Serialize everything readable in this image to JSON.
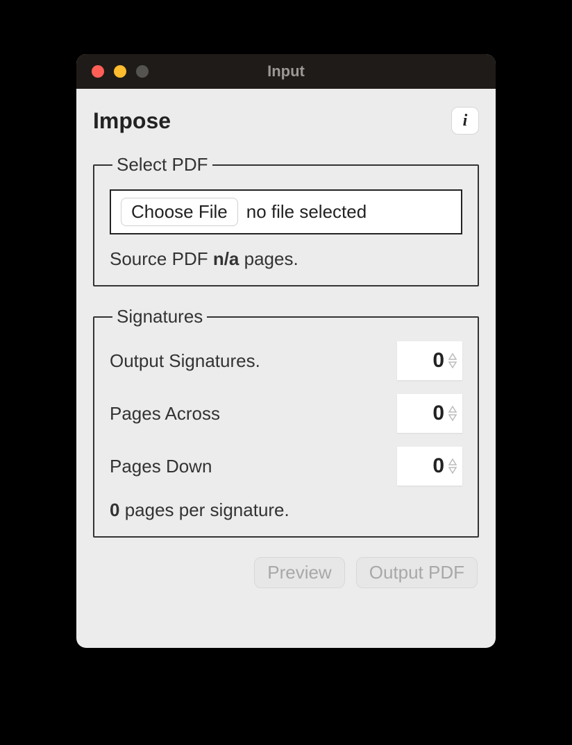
{
  "window": {
    "title": "Input"
  },
  "header": {
    "title": "Impose",
    "info_label": "i"
  },
  "select_pdf": {
    "legend": "Select PDF",
    "choose_label": "Choose File",
    "no_file_label": "no file selected",
    "source_prefix": "Source PDF ",
    "page_count": "n/a",
    "source_suffix": " pages."
  },
  "signatures": {
    "legend": "Signatures",
    "rows": [
      {
        "label": "Output Signatures.",
        "value": "0"
      },
      {
        "label": "Pages Across",
        "value": "0"
      },
      {
        "label": "Pages Down",
        "value": "0"
      }
    ],
    "summary_count": "0",
    "summary_suffix": " pages per signature."
  },
  "footer": {
    "preview_label": "Preview",
    "output_label": "Output PDF"
  }
}
